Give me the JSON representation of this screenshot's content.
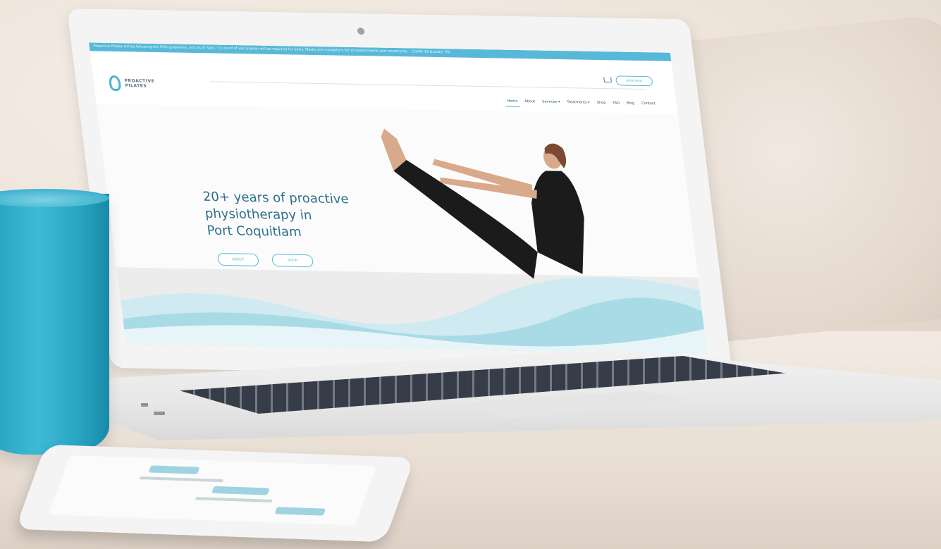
{
  "site": {
    "banner": "Proactive Pilates will be following the PHO guidelines, and as of Sept. 13, proof of vaccination will be required for entry. Masks are mandatory for all assessments and treatments. · COVID-19 Update: Plo",
    "logo_line1": "PROACTIVE",
    "logo_line2": "PILATES",
    "book_button": "BOOK NOW",
    "nav": [
      "Home",
      "About",
      "Services ▾",
      "Treatments ▾",
      "Shop",
      "FAQ",
      "Blog",
      "Contact"
    ],
    "headline": [
      "20+ years of proactive",
      "physiotherapy in",
      "Port Coquitlam"
    ],
    "buttons": {
      "about": "ABOUT",
      "shop": "SHOP"
    }
  },
  "colors": {
    "brand_blue": "#57b9d7",
    "text_blue": "#2f6f8a",
    "mug_blue": "#2aa6c4",
    "wave_light": "#cfeaf0"
  },
  "icons": [
    "cart-icon",
    "pilates-logo-icon",
    "camera-icon"
  ]
}
